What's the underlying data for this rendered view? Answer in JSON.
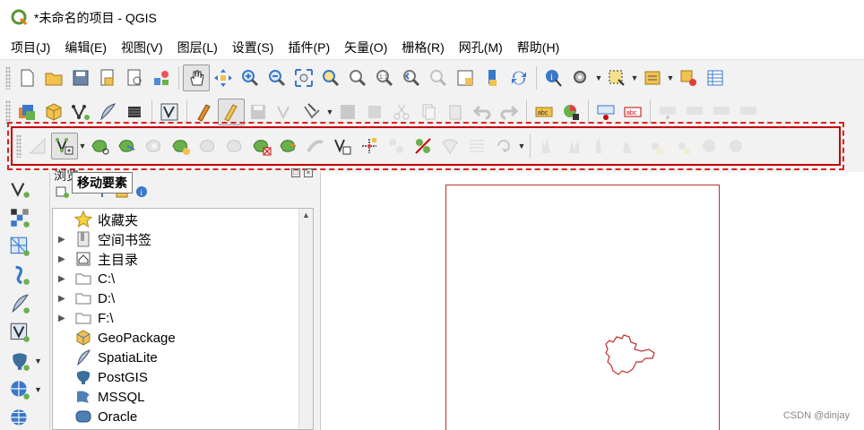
{
  "window": {
    "title": "*未命名的项目 - QGIS"
  },
  "menu": {
    "items": [
      "项目(J)",
      "编辑(E)",
      "视图(V)",
      "图层(L)",
      "设置(S)",
      "插件(P)",
      "矢量(O)",
      "栅格(R)",
      "网孔(M)",
      "帮助(H)"
    ]
  },
  "tooltip": {
    "text": "移动要素"
  },
  "browser_panel": {
    "title": "浏览",
    "tree": [
      {
        "label": "收藏夹",
        "icon": "star-icon",
        "expandable": false
      },
      {
        "label": "空间书签",
        "icon": "bookmark-icon",
        "expandable": true
      },
      {
        "label": "主目录",
        "icon": "home-icon",
        "expandable": true
      },
      {
        "label": "C:\\",
        "icon": "folder-icon",
        "expandable": true
      },
      {
        "label": "D:\\",
        "icon": "folder-icon",
        "expandable": true
      },
      {
        "label": "F:\\",
        "icon": "folder-icon",
        "expandable": true
      },
      {
        "label": "GeoPackage",
        "icon": "geopackage-icon",
        "expandable": false
      },
      {
        "label": "SpatiaLite",
        "icon": "spatialite-icon",
        "expandable": false
      },
      {
        "label": "PostGIS",
        "icon": "postgis-icon",
        "expandable": false
      },
      {
        "label": "MSSQL",
        "icon": "mssql-icon",
        "expandable": false
      },
      {
        "label": "Oracle",
        "icon": "oracle-icon",
        "expandable": false
      }
    ]
  },
  "watermark": "CSDN @dinjay",
  "colors": {
    "accent_green": "#6ab04c",
    "highlight_red": "#e02020",
    "map_stroke": "#c03030",
    "folder": "#ffffff"
  }
}
